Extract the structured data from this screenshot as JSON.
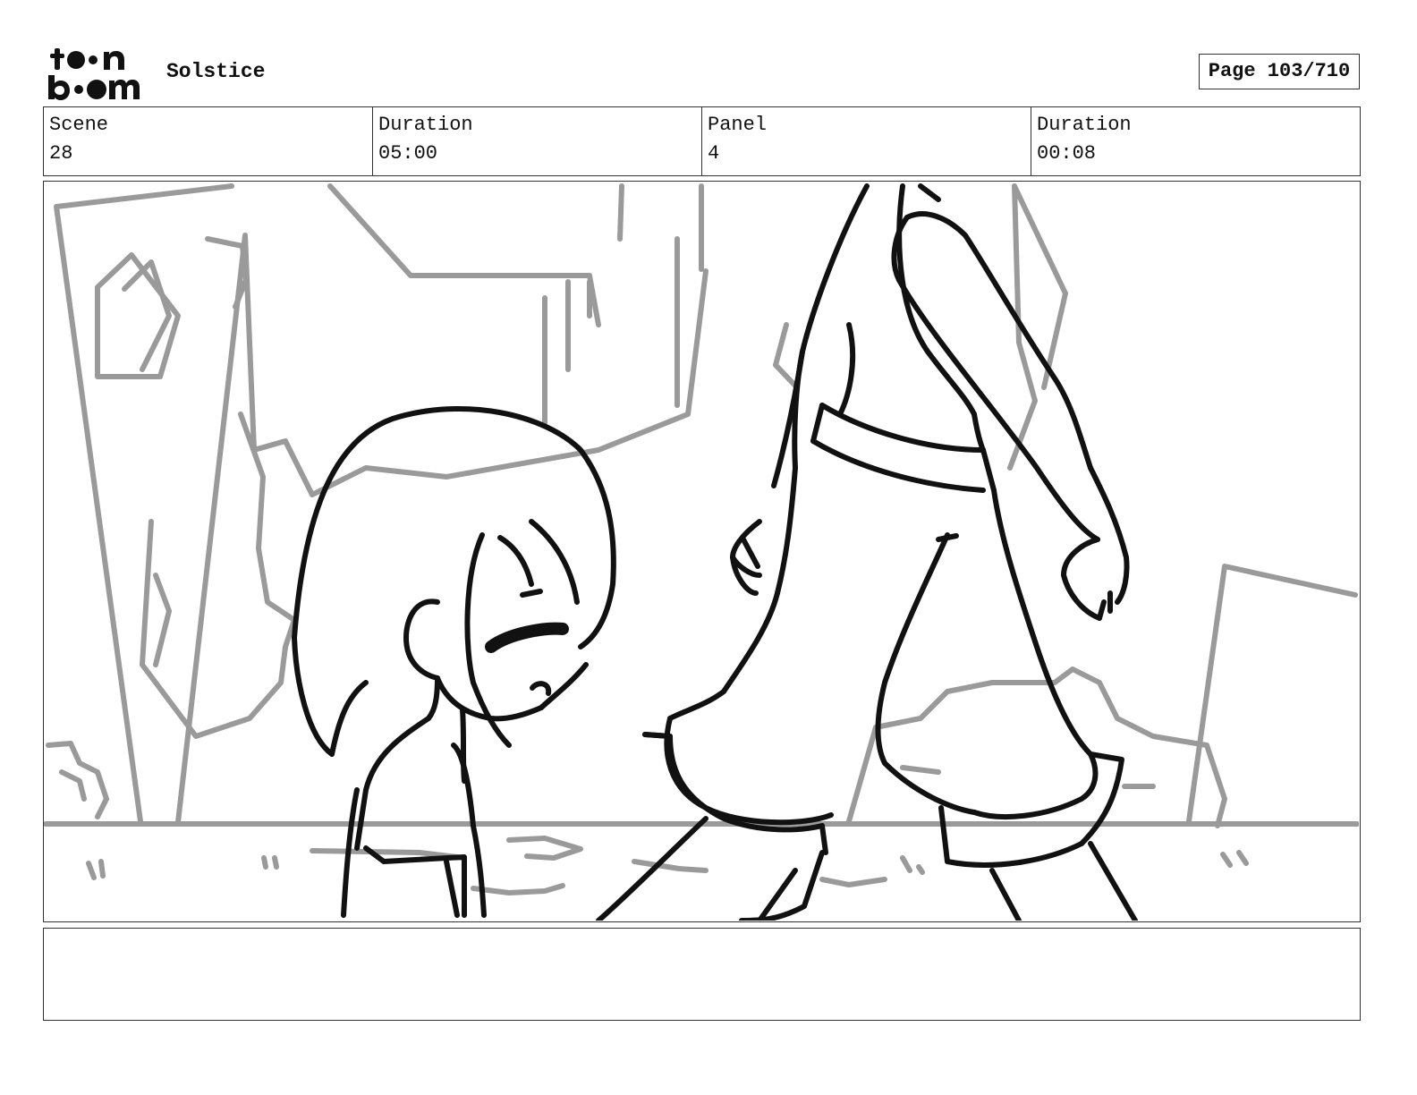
{
  "header": {
    "logo_text": "toon boom",
    "project_title": "Solstice",
    "page_indicator": "Page 103/710"
  },
  "info": {
    "scene_label": "Scene",
    "scene_value": "28",
    "scene_duration_label": "Duration",
    "scene_duration_value": "05:00",
    "panel_label": "Panel",
    "panel_value": "4",
    "panel_duration_label": "Duration",
    "panel_duration_value": "00:08"
  },
  "panel": {
    "drawing_colors": {
      "line_art": "#111111",
      "background_art": "#9a9a9a"
    }
  },
  "notes": {
    "text": ""
  }
}
